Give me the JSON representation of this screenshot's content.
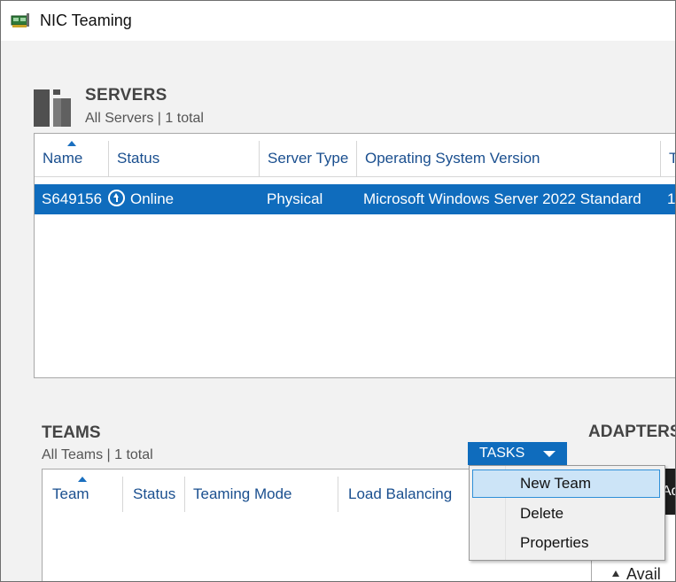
{
  "window": {
    "title": "NIC Teaming"
  },
  "servers": {
    "title": "SERVERS",
    "subtitle": "All Servers | 1 total",
    "columns": [
      "Name",
      "Status",
      "Server Type",
      "Operating System Version",
      "T"
    ],
    "rows": [
      {
        "name": "S649156",
        "status": "Online",
        "server_type": "Physical",
        "os": "Microsoft Windows Server 2022 Standard",
        "extra": "1"
      }
    ]
  },
  "teams": {
    "title": "TEAMS",
    "subtitle": "All Teams | 1 total",
    "columns": [
      "Team",
      "Status",
      "Teaming Mode",
      "Load Balancing"
    ]
  },
  "tasks_button": {
    "label": "TASKS"
  },
  "tasks_menu": {
    "items": [
      "New Team",
      "Delete",
      "Properties"
    ],
    "highlighted": "New Team"
  },
  "adapters": {
    "title": "ADAPTERS",
    "button_label": "Ad",
    "tree_item": "Avail"
  },
  "colors": {
    "selection": "#0f6cbd",
    "header_text": "#1a4f8f",
    "menu_highlight": "#cce4f7"
  }
}
